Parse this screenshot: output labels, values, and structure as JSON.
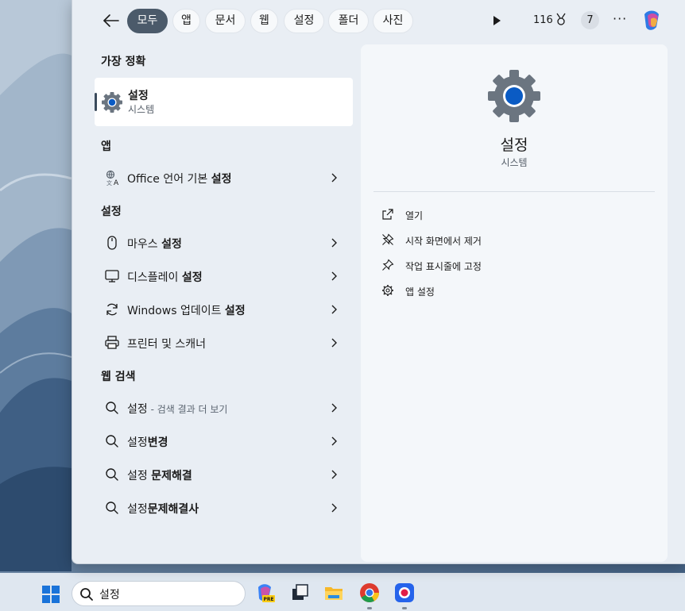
{
  "topbar": {
    "filters": [
      {
        "label": "모두",
        "active": true
      },
      {
        "label": "앱",
        "active": false
      },
      {
        "label": "문서",
        "active": false
      },
      {
        "label": "웹",
        "active": false
      },
      {
        "label": "설정",
        "active": false
      },
      {
        "label": "폴더",
        "active": false
      },
      {
        "label": "사진",
        "active": false
      }
    ],
    "points": "116",
    "badge_count": "7"
  },
  "best_match": {
    "section_title": "가장 정확",
    "name": "설정",
    "subtitle": "시스템"
  },
  "apps": {
    "section_title": "앱",
    "items": [
      {
        "prefix": "Office 언어 기본 ",
        "bold": "설정",
        "icon": "office-language-icon"
      }
    ]
  },
  "settings": {
    "section_title": "설정",
    "items": [
      {
        "prefix": "마우스 ",
        "bold": "설정",
        "icon": "mouse-icon"
      },
      {
        "prefix": "디스플레이 ",
        "bold": "설정",
        "icon": "monitor-icon"
      },
      {
        "prefix": "Windows 업데이트 ",
        "bold": "설정",
        "icon": "refresh-icon"
      },
      {
        "prefix": "프린터 및 스캐너",
        "bold": "",
        "icon": "printer-icon"
      }
    ]
  },
  "web": {
    "section_title": "웹 검색",
    "items": [
      {
        "prefix": "설정",
        "bold": "",
        "hint": " - 검색 결과 더 보기"
      },
      {
        "prefix": "설정",
        "bold": "변경",
        "hint": ""
      },
      {
        "prefix": "설정 ",
        "bold": "문제해결",
        "hint": ""
      },
      {
        "prefix": "설정",
        "bold": "문제해결사",
        "hint": ""
      }
    ]
  },
  "detail": {
    "title": "설정",
    "subtitle": "시스템",
    "actions": [
      {
        "label": "열기",
        "icon": "open-external-icon"
      },
      {
        "label": "시작 화면에서 제거",
        "icon": "unpin-icon"
      },
      {
        "label": "작업 표시줄에 고정",
        "icon": "pin-icon"
      },
      {
        "label": "앱 설정",
        "icon": "gear-icon"
      }
    ]
  },
  "taskbar": {
    "search_value": "설정",
    "apps": [
      "copilot-pre-icon",
      "task-view-icon",
      "file-explorer-icon",
      "chrome-icon",
      "recorder-icon"
    ]
  },
  "colors": {
    "accent": "#0a5bc4",
    "active_chip": "#4b5a6a"
  }
}
